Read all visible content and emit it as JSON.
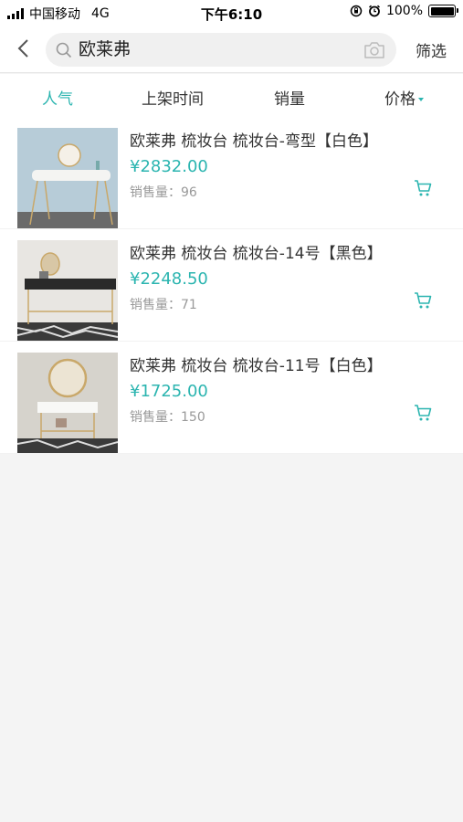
{
  "status_bar": {
    "carrier": "中国移动",
    "network": "4G",
    "time": "下午6:10",
    "battery": "100%"
  },
  "search": {
    "query": "欧莱弗",
    "filter_label": "筛选"
  },
  "sort_tabs": [
    {
      "label": "人气",
      "active": true
    },
    {
      "label": "上架时间",
      "active": false
    },
    {
      "label": "销量",
      "active": false
    },
    {
      "label": "价格",
      "active": false
    }
  ],
  "products": [
    {
      "title": "欧莱弗 梳妆台 梳妆台-弯型【白色】",
      "price": "¥2832.00",
      "sales_label": "销售量：",
      "sales": "96"
    },
    {
      "title": "欧莱弗 梳妆台 梳妆台-14号【黑色】",
      "price": "¥2248.50",
      "sales_label": "销售量：",
      "sales": "71"
    },
    {
      "title": "欧莱弗 梳妆台 梳妆台-11号【白色】",
      "price": "¥1725.00",
      "sales_label": "销售量：",
      "sales": "150"
    }
  ],
  "colors": {
    "accent": "#2cb5b0",
    "background": "#f4f4f4"
  }
}
